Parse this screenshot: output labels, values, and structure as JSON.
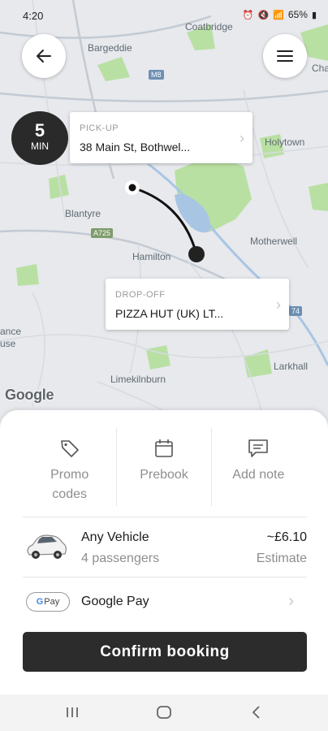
{
  "status": {
    "time": "4:20",
    "battery": "65%"
  },
  "map": {
    "places": [
      "Coatbridge",
      "Bargeddie",
      "Holytown",
      "Blantyre",
      "Hamilton",
      "Motherwell",
      "Larkhall",
      "Limekilnburn",
      "ance",
      "use",
      "Cha"
    ],
    "road_badges": [
      "M8",
      "A725",
      "74"
    ],
    "attribution": "Google"
  },
  "eta": {
    "value": "5",
    "unit": "MIN"
  },
  "pickup": {
    "label": "PICK-UP",
    "value": "38 Main St, Bothwel..."
  },
  "dropoff": {
    "label": "DROP-OFF",
    "value": "PIZZA HUT (UK) LT..."
  },
  "options": [
    {
      "label": "Promo codes",
      "icon": "tag-icon"
    },
    {
      "label": "Prebook",
      "icon": "calendar-icon"
    },
    {
      "label": "Add note",
      "icon": "chat-icon"
    }
  ],
  "vehicle": {
    "name": "Any Vehicle",
    "passengers": "4 passengers",
    "price": "~£6.10",
    "price_note": "Estimate"
  },
  "payment": {
    "badge": "Pay",
    "badge_g": "G",
    "label": "Google Pay"
  },
  "confirm": {
    "label": "Confirm booking"
  },
  "colors": {
    "primary": "#2c2c2c",
    "map_bg": "#e7e9ec",
    "park_green": "#a8dc8f",
    "water": "#a9c5e4"
  }
}
